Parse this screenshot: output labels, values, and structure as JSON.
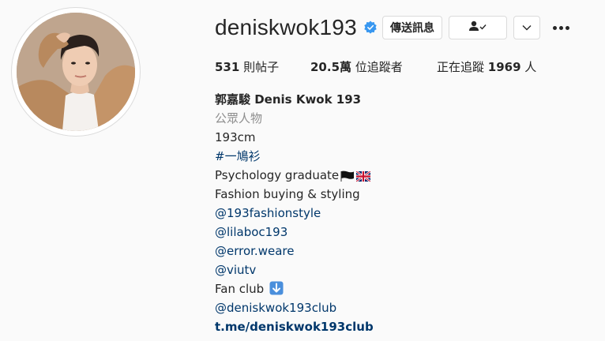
{
  "profile": {
    "username": "deniskwok193",
    "verified": true,
    "accent_color": "#3897f0"
  },
  "actions": {
    "message_label": "傳送訊息",
    "following_icon": "person-check-icon",
    "dropdown_icon": "chevron-down-icon",
    "more_icon": "more-horizontal-icon"
  },
  "stats": {
    "posts_count": "531",
    "posts_label": " 則帖子",
    "followers_count": "20.5萬",
    "followers_label": " 位追蹤者",
    "following_prefix": "正在追蹤 ",
    "following_count": "1969",
    "following_suffix": " 人"
  },
  "bio": {
    "full_name": "郭嘉駿 Denis Kwok 193",
    "category": "公眾人物",
    "lines": [
      "193cm",
      "#一鳩衫",
      "Psychology graduate",
      "Fashion buying & styling",
      "@193fashionstyle",
      "@lilaboc193",
      "@error.weare",
      "@viutv",
      "Fan club",
      "@deniskwok193club"
    ],
    "website": "t.me/deniskwok193club"
  }
}
